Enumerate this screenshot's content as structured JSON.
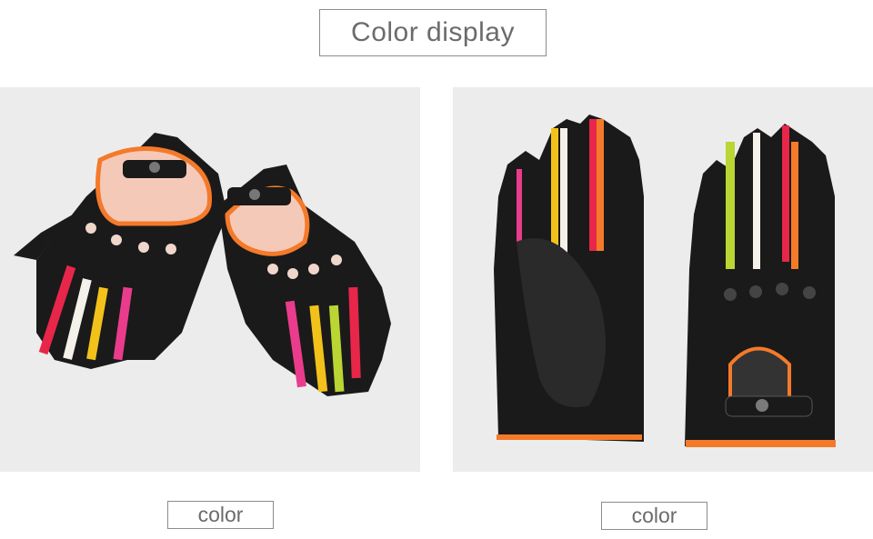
{
  "header": {
    "title": "Color display"
  },
  "products": [
    {
      "caption": "color"
    },
    {
      "caption": "color"
    }
  ],
  "colors": {
    "background": "#ececec",
    "leather": "#1a1a1a",
    "trim_orange": "#f47a2a",
    "accent_red": "#e8264a",
    "accent_pink": "#ea3c8c",
    "accent_yellow": "#f3c21a",
    "accent_lime": "#b9d633",
    "accent_white": "#f4f1ea"
  }
}
